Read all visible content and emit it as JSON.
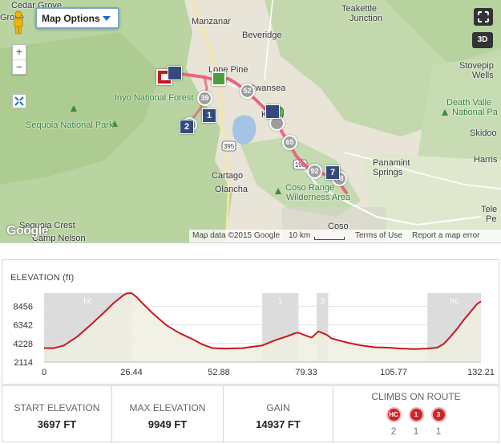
{
  "map": {
    "options_label": "Map Options",
    "btn_3d": "3D",
    "zoom_in": "+",
    "zoom_out": "−",
    "labels": {
      "cedar_grove": "Cedar Grove",
      "manzanar": "Manzanar",
      "teakettle": "Teakettle",
      "junction": "Junction",
      "beveridge": "Beveridge",
      "stovepipe": "Stovepip",
      "wells": "Wells",
      "lone_pine": "Lone Pine",
      "inyo_forest": "Inyo National Forest",
      "swansea": "Swansea",
      "keeler": "Ke",
      "death_valley_1": "Death Valle",
      "death_valley_2": "National Pa",
      "sequoia_np": "Sequoia National Park",
      "skidoo": "Skidoo",
      "panamint_1": "Panamint",
      "panamint_2": "Springs",
      "harris": "Harris",
      "cartago": "Cartago",
      "olancha": "Olancha",
      "coso_range_1": "Coso Range",
      "coso_range_2": "Wilderness Area",
      "sequoia_crest": "Sequoia Crest",
      "camp_nelson": "Camp Nelson",
      "coso": "Coso",
      "fire_grove": "Grove",
      "tele_1": "Tele",
      "tele_2": "Pe"
    },
    "route_badges": [
      "39",
      "52",
      "65",
      "92",
      "78"
    ],
    "square_markers": [
      "2",
      "1",
      "7"
    ],
    "footer": {
      "data": "Map data ©2015 Google",
      "scale": "10 km",
      "terms": "Terms of Use",
      "report": "Report a map error"
    },
    "google": "Google"
  },
  "elevation": {
    "title": "ELEVATION (ft)",
    "y_ticks": [
      "8456",
      "6342",
      "4228",
      "2114"
    ],
    "x_ticks": [
      "0",
      "26.44",
      "52.88",
      "79.33",
      "105.77",
      "132.21"
    ],
    "segments": [
      "hc",
      "1",
      "3",
      "hc"
    ]
  },
  "chart_data": {
    "type": "area",
    "title": "ELEVATION (ft)",
    "xlabel": "",
    "ylabel": "",
    "xlim": [
      0,
      132.21
    ],
    "ylim": [
      2114,
      9949
    ],
    "x": [
      0,
      3,
      6,
      10,
      14,
      18,
      21,
      23,
      24,
      25,
      26.44,
      28,
      30,
      33,
      37,
      41,
      45,
      48,
      51,
      55,
      60,
      66,
      70,
      74,
      76,
      77,
      79.33,
      81,
      83,
      85,
      86,
      87,
      89,
      92,
      96,
      100,
      104,
      108,
      112,
      116,
      119,
      121,
      123,
      125,
      127,
      129,
      131,
      132.21
    ],
    "y": [
      3697,
      3700,
      4000,
      5000,
      6300,
      7700,
      8800,
      9400,
      9700,
      9900,
      9949,
      9500,
      8700,
      7600,
      6300,
      5400,
      4700,
      4100,
      3700,
      3650,
      3700,
      4000,
      4600,
      5100,
      5400,
      5450,
      5100,
      4900,
      5600,
      5300,
      5100,
      4800,
      4600,
      4300,
      4000,
      3800,
      3750,
      3650,
      3600,
      3650,
      3750,
      4200,
      5000,
      5900,
      6900,
      7800,
      8700,
      9000
    ],
    "shaded_ranges": [
      [
        0,
        26.44
      ],
      [
        66,
        77
      ],
      [
        82.5,
        86
      ],
      [
        116,
        132.21
      ]
    ],
    "shaded_labels": [
      "hc",
      "1",
      "3",
      "hc"
    ],
    "grid": true,
    "line_color": "#c8171d",
    "fill_color": "#efeee0"
  },
  "stats": {
    "start_label": "START ELEVATION",
    "start_value": "3697 FT",
    "max_label": "MAX ELEVATION",
    "max_value": "9949 FT",
    "gain_label": "GAIN",
    "gain_value": "14937 FT",
    "climbs_label": "CLIMBS ON ROUTE",
    "climbs": [
      {
        "badge": "HC",
        "count": "2"
      },
      {
        "badge": "1",
        "count": "1"
      },
      {
        "badge": "3",
        "count": "1"
      }
    ]
  },
  "colors": {
    "route": "#e8607a",
    "accent": "#1e6fb8",
    "climb": "#d3232a"
  }
}
